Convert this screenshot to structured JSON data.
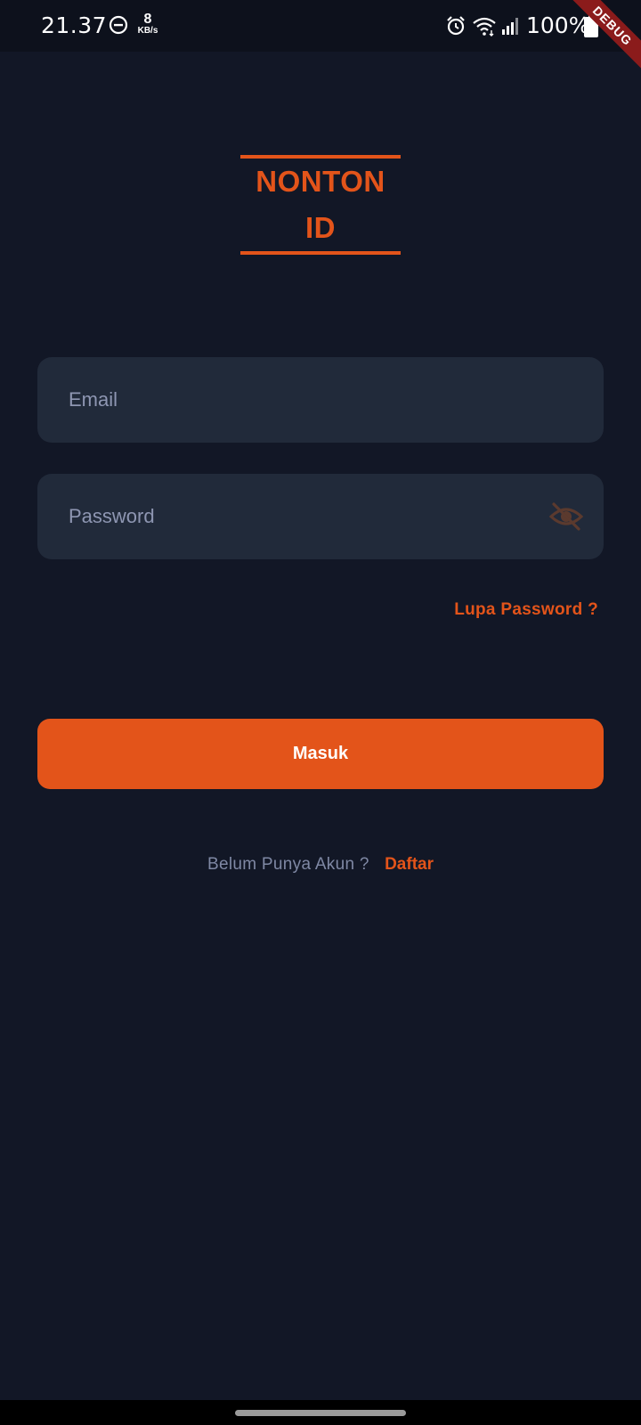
{
  "status_bar": {
    "time": "21.37",
    "net_speed_value": "8",
    "net_speed_unit": "KB/s",
    "battery": "100%",
    "icons": [
      "do-not-disturb-icon",
      "alarm-icon",
      "wifi-icon",
      "signal-icon",
      "battery-icon"
    ]
  },
  "debug_banner": "DEBUG",
  "logo": {
    "line1": "NONTON",
    "line2": "ID"
  },
  "form": {
    "email_placeholder": "Email",
    "password_placeholder": "Password",
    "forgot_password": "Lupa Password ?",
    "submit_label": "Masuk"
  },
  "register": {
    "prompt": "Belum Punya Akun ?",
    "link": "Daftar"
  },
  "colors": {
    "background": "#121726",
    "accent": "#e3541a",
    "field_background": "#212a3a",
    "muted_text": "#7f88a4"
  }
}
